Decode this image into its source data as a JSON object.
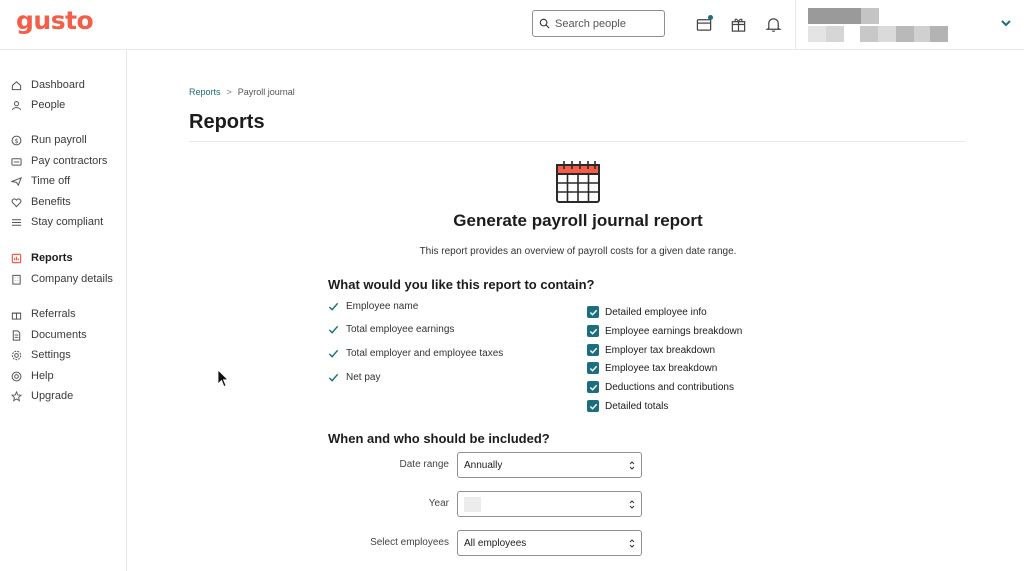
{
  "header": {
    "logo": "gusto",
    "search_placeholder": "Search people"
  },
  "sidebar": {
    "items": [
      {
        "label": "Dashboard",
        "icon": "home-icon"
      },
      {
        "label": "People",
        "icon": "people-icon"
      },
      {
        "label": "Run payroll",
        "icon": "dollar-icon"
      },
      {
        "label": "Pay contractors",
        "icon": "contractor-card-icon"
      },
      {
        "label": "Time off",
        "icon": "plane-icon"
      },
      {
        "label": "Benefits",
        "icon": "heart-icon"
      },
      {
        "label": "Stay compliant",
        "icon": "list-icon"
      },
      {
        "label": "Reports",
        "icon": "reports-icon"
      },
      {
        "label": "Company details",
        "icon": "building-icon"
      },
      {
        "label": "Referrals",
        "icon": "gift-icon"
      },
      {
        "label": "Documents",
        "icon": "document-icon"
      },
      {
        "label": "Settings",
        "icon": "gear-icon"
      },
      {
        "label": "Help",
        "icon": "help-icon"
      },
      {
        "label": "Upgrade",
        "icon": "star-icon"
      }
    ]
  },
  "breadcrumb": {
    "parent": "Reports",
    "separator": ">",
    "current": "Payroll journal"
  },
  "page_title": "Reports",
  "report": {
    "heading": "Generate payroll journal report",
    "description": "This report provides an overview of payroll costs for a given date range.",
    "contents_title": "What would you like this report to contain?",
    "included": [
      "Employee name",
      "Total employee earnings",
      "Total employer and employee taxes",
      "Net pay"
    ],
    "optional": [
      {
        "label": "Detailed employee info",
        "checked": true
      },
      {
        "label": "Employee earnings breakdown",
        "checked": true
      },
      {
        "label": "Employer tax breakdown",
        "checked": true
      },
      {
        "label": "Employee tax breakdown",
        "checked": true
      },
      {
        "label": "Deductions and contributions",
        "checked": true
      },
      {
        "label": "Detailed totals",
        "checked": true
      }
    ],
    "filters_title": "When and who should be included?",
    "filters": {
      "date_range_label": "Date range",
      "date_range_value": "Annually",
      "year_label": "Year",
      "employees_label": "Select employees",
      "employees_value": "All employees"
    }
  },
  "colors": {
    "brand": "#f45d48",
    "accent": "#1b6e7d"
  }
}
